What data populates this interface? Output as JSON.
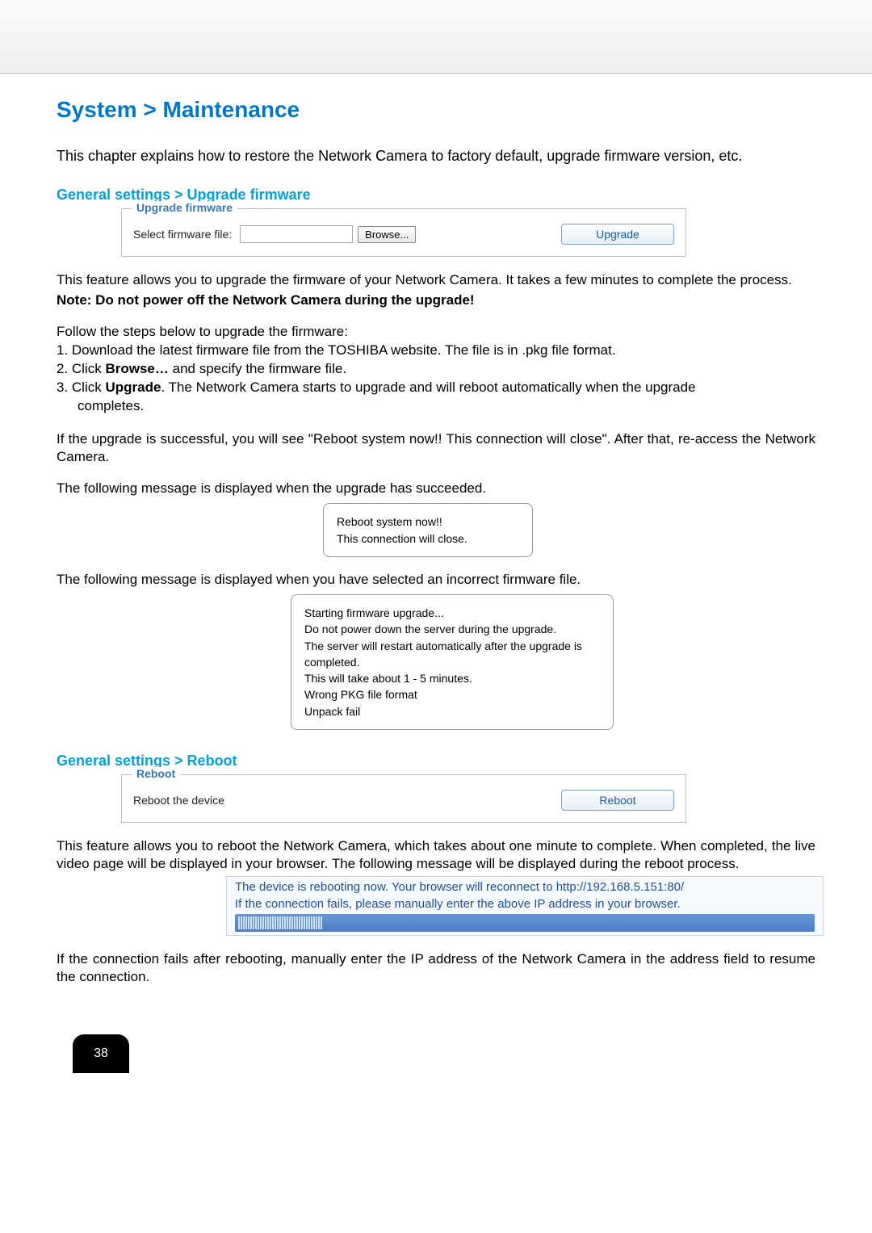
{
  "header": {
    "title": "System > Maintenance"
  },
  "intro": "This chapter explains how to restore the Network Camera to factory default, upgrade firmware version, etc.",
  "section1": {
    "heading": "General settings > Upgrade firmware",
    "fieldset_legend": "Upgrade firmware",
    "label": "Select firmware file:",
    "browse_label": "Browse...",
    "upgrade_label": "Upgrade"
  },
  "upgrade_desc": "This feature allows you to upgrade the firmware of your Network Camera. It takes a few minutes to complete the process.",
  "upgrade_note": "Note: Do not power off the Network Camera during the upgrade!",
  "steps_intro": "Follow the steps below to upgrade the firmware:",
  "steps": {
    "s1": "1. Download the latest firmware file from the TOSHIBA website. The file is in .pkg file format.",
    "s2a": "2. Click ",
    "s2b": "Browse…",
    "s2c": " and specify the firmware file.",
    "s3a": "3. Click ",
    "s3b": "Upgrade",
    "s3c": ". The Network Camera starts to upgrade and will reboot automatically when the upgrade",
    "s3d": "completes."
  },
  "after_upgrade": "If the upgrade is successful, you will see \"Reboot system now!! This connection will close\". After that, re-access the Network Camera.",
  "succ_intro": "The following message is displayed when the upgrade has succeeded.",
  "succ_msg": {
    "l1": "Reboot system now!!",
    "l2": "This connection will close."
  },
  "fail_intro": "The following message is displayed when you have selected an incorrect firmware file.",
  "fail_msg": {
    "l1": "Starting firmware upgrade...",
    "l2": "Do not power down the server during the upgrade.",
    "l3": "The server will restart automatically after the upgrade is completed.",
    "l4": "This will take about 1 - 5 minutes.",
    "l5": "Wrong PKG file format",
    "l6": "Unpack fail"
  },
  "section2": {
    "heading": "General settings > Reboot",
    "fieldset_legend": "Reboot",
    "label": "Reboot the device",
    "reboot_label": "Reboot"
  },
  "reboot_desc": "This feature allows you to reboot the Network Camera, which takes about one minute to complete. When completed, the live video page will be displayed in your browser. The following message will be displayed during the reboot process.",
  "reboot_msg": {
    "l1": "The device is rebooting now. Your browser will reconnect to http://192.168.5.151:80/",
    "l2": "If the connection fails, please manually enter the above IP address in your browser."
  },
  "footer_text": "If the connection fails after rebooting, manually enter the IP address of the Network Camera in the address field to resume the connection.",
  "page_number": "38"
}
